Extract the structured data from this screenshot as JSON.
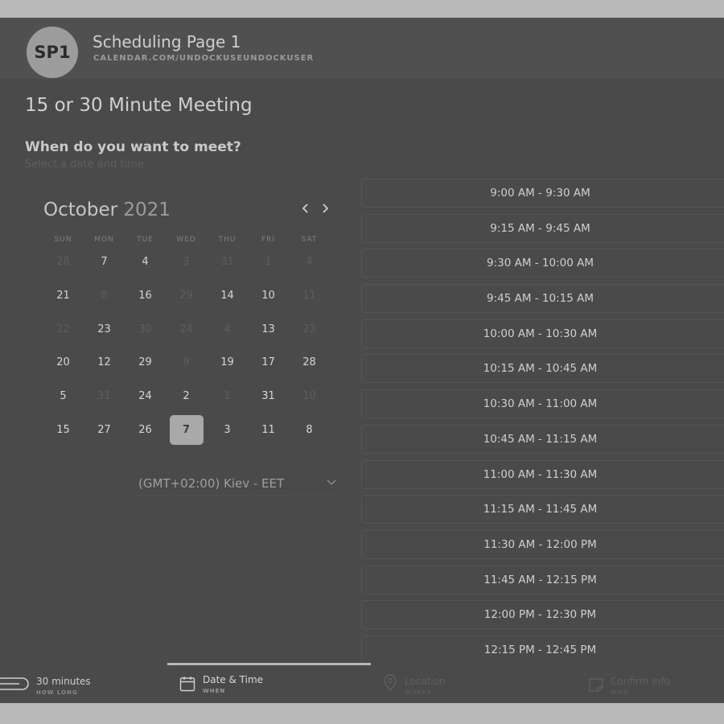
{
  "header": {
    "avatar_initials": "SP1",
    "page_name": "Scheduling Page 1",
    "page_url": "CALENDAR.COM/UNDOCKUSEUNDOCKUSER"
  },
  "meeting": {
    "title": "15 or 30 Minute Meeting",
    "question": "When do you want to meet?",
    "hint": "Select a date and time"
  },
  "calendar": {
    "month": "October",
    "year": "2021",
    "prev_icon": "chevron-left-icon",
    "next_icon": "chevron-right-icon",
    "weekdays": [
      "SUN",
      "MON",
      "TUE",
      "WED",
      "THU",
      "FRI",
      "SAT"
    ],
    "weeks": [
      [
        {
          "d": "28",
          "m": true
        },
        {
          "d": "7",
          "m": false
        },
        {
          "d": "4",
          "m": false
        },
        {
          "d": "3",
          "m": true
        },
        {
          "d": "31",
          "m": true
        },
        {
          "d": "1",
          "m": true
        },
        {
          "d": "4",
          "m": true
        }
      ],
      [
        {
          "d": "21",
          "m": false
        },
        {
          "d": "8",
          "m": true
        },
        {
          "d": "16",
          "m": false
        },
        {
          "d": "29",
          "m": true
        },
        {
          "d": "14",
          "m": false
        },
        {
          "d": "10",
          "m": false
        },
        {
          "d": "11",
          "m": true
        }
      ],
      [
        {
          "d": "22",
          "m": true
        },
        {
          "d": "23",
          "m": false
        },
        {
          "d": "30",
          "m": true
        },
        {
          "d": "24",
          "m": true
        },
        {
          "d": "4",
          "m": true
        },
        {
          "d": "13",
          "m": false
        },
        {
          "d": "23",
          "m": true
        }
      ],
      [
        {
          "d": "20",
          "m": false
        },
        {
          "d": "12",
          "m": false
        },
        {
          "d": "29",
          "m": false
        },
        {
          "d": "9",
          "m": true
        },
        {
          "d": "19",
          "m": false
        },
        {
          "d": "17",
          "m": false
        },
        {
          "d": "28",
          "m": false
        }
      ],
      [
        {
          "d": "5",
          "m": false
        },
        {
          "d": "31",
          "m": true
        },
        {
          "d": "24",
          "m": false
        },
        {
          "d": "2",
          "m": false
        },
        {
          "d": "1",
          "m": true
        },
        {
          "d": "31",
          "m": false
        },
        {
          "d": "10",
          "m": true
        }
      ],
      [
        {
          "d": "15",
          "m": false
        },
        {
          "d": "27",
          "m": false
        },
        {
          "d": "26",
          "m": false
        },
        {
          "d": "7",
          "m": false,
          "selected": true
        },
        {
          "d": "3",
          "m": false
        },
        {
          "d": "11",
          "m": false
        },
        {
          "d": "8",
          "m": false
        }
      ]
    ],
    "timezone": "(GMT+02:00) Kiev - EET",
    "timezone_icon": "chevron-down-icon"
  },
  "time_slots": [
    "9:00 AM - 9:30 AM",
    "9:15 AM - 9:45 AM",
    "9:30 AM - 10:00 AM",
    "9:45 AM - 10:15 AM",
    "10:00 AM - 10:30 AM",
    "10:15 AM - 10:45 AM",
    "10:30 AM - 11:00 AM",
    "10:45 AM - 11:15 AM",
    "11:00 AM - 11:30 AM",
    "11:15 AM - 11:45 AM",
    "11:30 AM - 12:00 PM",
    "11:45 AM - 12:15 PM",
    "12:00 PM - 12:30 PM",
    "12:15 PM - 12:45 PM"
  ],
  "steps": [
    {
      "label": "30 minutes",
      "sub": "HOW LONG",
      "icon": "duration-pill-icon",
      "state": "done"
    },
    {
      "label": "Date & Time",
      "sub": "WHEN",
      "icon": "calendar-icon",
      "state": "active"
    },
    {
      "label": "Location",
      "sub": "WHERE",
      "icon": "location-pin-icon",
      "state": "pending"
    },
    {
      "label": "Confirm Info",
      "sub": "WHO",
      "icon": "note-icon",
      "state": "pending"
    }
  ]
}
